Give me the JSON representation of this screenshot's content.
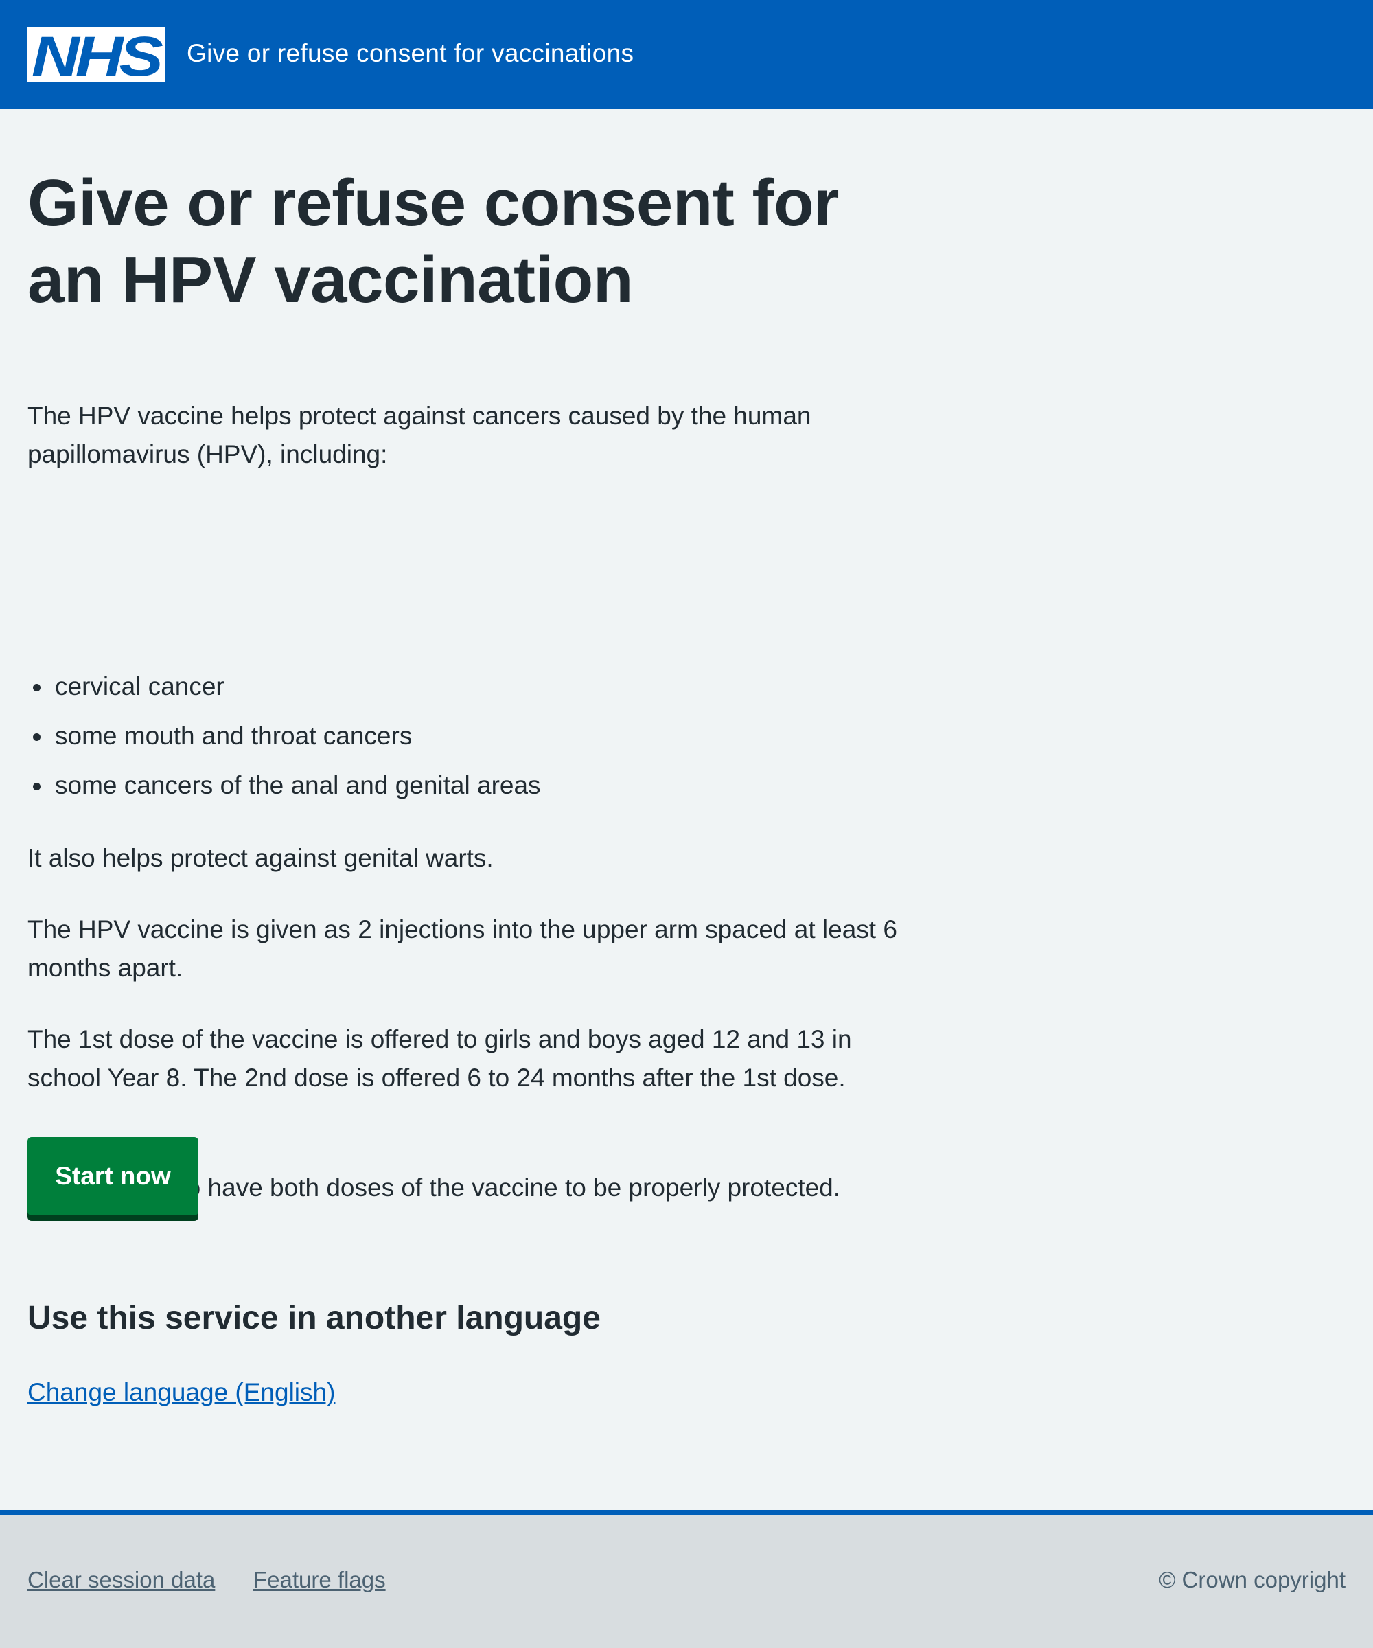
{
  "header": {
    "logo_text": "NHS",
    "service_name": "Give or refuse consent for vaccinations",
    "colors": {
      "background": "#005eb8",
      "logo_blue": "#005eb8",
      "logo_bg": "#ffffff"
    }
  },
  "main": {
    "title": "Give or refuse consent for an HPV vaccination",
    "intro": "The HPV vaccine helps protect against cancers caused by the human papillomavirus (HPV), including:",
    "bullets": [
      "cervical cancer",
      "some mouth and throat cancers",
      "some cancers of the anal and genital areas"
    ],
    "warts": "It also helps protect against genital warts.",
    "injections": "The HPV vaccine is given as 2 injections into the upper arm spaced at least 6 months apart.",
    "doses": "The 1st dose of the vaccine is offered to girls and boys aged 12 and 13 in school Year 8. The 2nd dose is offered 6 to 24 months after the 1st dose.",
    "important": "It’s important to have both doses of the vaccine to be properly protected.",
    "start_button": "Start now",
    "language_heading": "Use this service in another language",
    "language_link": "Change language (English)"
  },
  "footer": {
    "links": [
      "Clear session data",
      "Feature flags"
    ],
    "copyright": "© Crown copyright"
  },
  "colors": {
    "page_background": "#f0f4f5",
    "text": "#212b32",
    "link": "#005eb8",
    "button": "#007f3b",
    "button_shadow": "#00401e",
    "footer_background": "#d8dde0",
    "footer_text": "#4c6272"
  }
}
